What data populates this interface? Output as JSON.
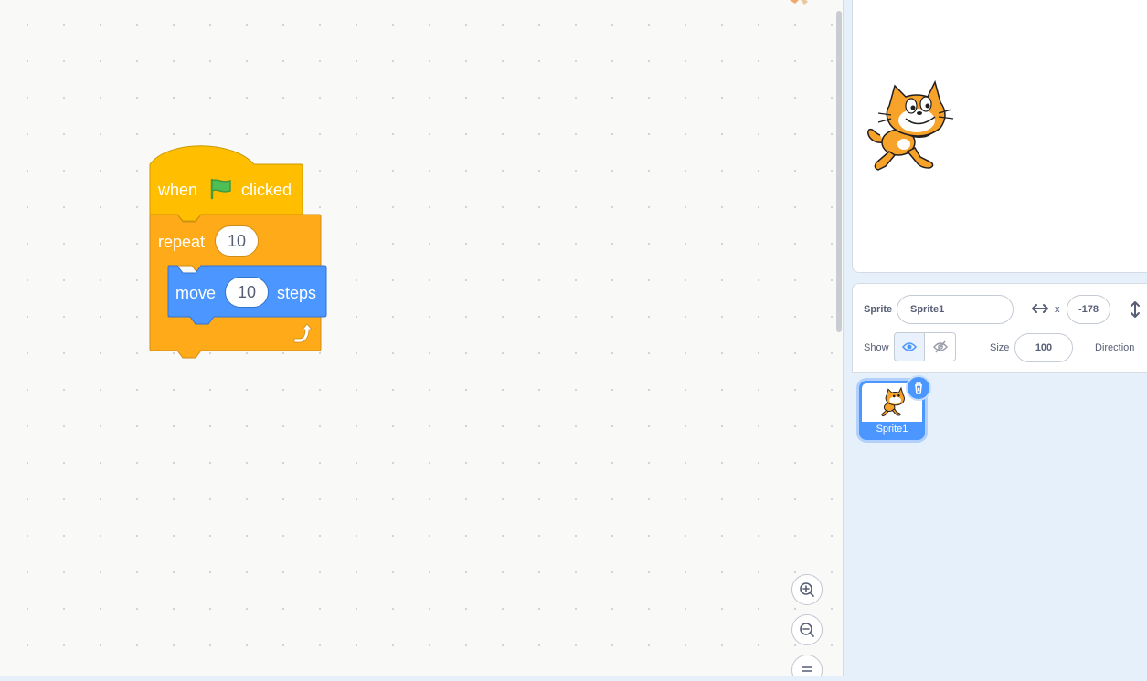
{
  "script": {
    "hat": {
      "word1": "when",
      "word2": "clicked",
      "flag_icon": "green-flag-icon"
    },
    "repeat": {
      "label": "repeat",
      "count": "10"
    },
    "move": {
      "label": "move",
      "steps": "10",
      "suffix": "steps"
    }
  },
  "zoom": {
    "in_icon": "zoom-in-icon",
    "out_icon": "zoom-out-icon",
    "reset_icon": "zoom-reset-icon"
  },
  "sprite_info": {
    "sprite_label": "Sprite",
    "sprite_name": "Sprite1",
    "x_label": "x",
    "x_value": "-178",
    "show_label": "Show",
    "size_label": "Size",
    "size_value": "100",
    "direction_label": "Direction"
  },
  "sprite_list": [
    {
      "name": "Sprite1",
      "selected": true
    }
  ],
  "colors": {
    "events": "#ffbf00",
    "control": "#ffab19",
    "motion": "#4c97ff",
    "workspace_bg": "#f9f9f8",
    "panel_bg": "#e6f0fa"
  }
}
